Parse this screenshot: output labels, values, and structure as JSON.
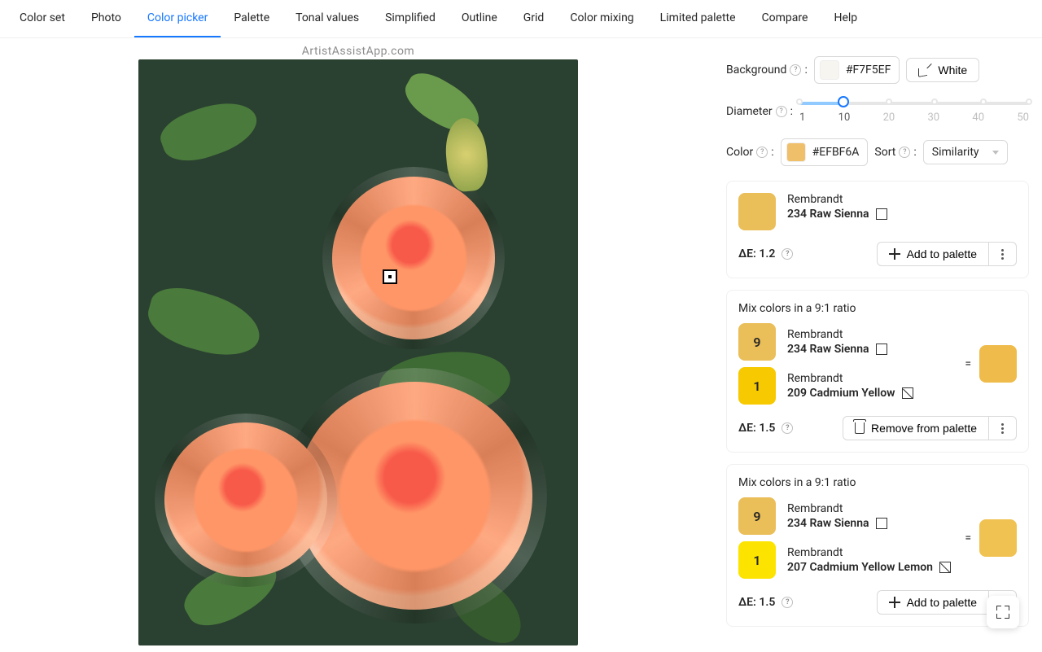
{
  "watermark": "ArtistAssistApp.com",
  "tabs": [
    "Color set",
    "Photo",
    "Color picker",
    "Palette",
    "Tonal values",
    "Simplified",
    "Outline",
    "Grid",
    "Color mixing",
    "Limited palette",
    "Compare",
    "Help"
  ],
  "active_tab_index": 2,
  "background": {
    "label": "Background",
    "value": "#F7F5EF",
    "white_button": "White"
  },
  "diameter": {
    "label": "Diameter",
    "marks": [
      "1",
      "10",
      "20",
      "30",
      "40",
      "50"
    ],
    "value_index": 1
  },
  "color": {
    "label": "Color",
    "value": "#EFBF6A"
  },
  "sort": {
    "label": "Sort",
    "value": "Similarity"
  },
  "delta_prefix": "ΔE: ",
  "add_to_palette": "Add to palette",
  "remove_from_palette": "Remove from palette",
  "cards": [
    {
      "type": "single",
      "swatch": "#EABE59",
      "brand": "Rembrandt",
      "name": "234 Raw Sienna",
      "attr_icon": "square",
      "delta": "1.2",
      "action": "add"
    },
    {
      "type": "mix",
      "mix_label": "Mix colors in a 9:1 ratio",
      "parts": [
        {
          "ratio": "9",
          "swatch": "#EABE59",
          "brand": "Rembrandt",
          "name": "234 Raw Sienna",
          "attr_icon": "square"
        },
        {
          "ratio": "1",
          "swatch": "#F6C900",
          "brand": "Rembrandt",
          "name": "209 Cadmium Yellow",
          "attr_icon": "diag"
        }
      ],
      "result": "#EFBC4B",
      "delta": "1.5",
      "action": "remove"
    },
    {
      "type": "mix",
      "mix_label": "Mix colors in a 9:1 ratio",
      "parts": [
        {
          "ratio": "9",
          "swatch": "#EABE59",
          "brand": "Rembrandt",
          "name": "234 Raw Sienna",
          "attr_icon": "square"
        },
        {
          "ratio": "1",
          "swatch": "#FCE400",
          "brand": "Rembrandt",
          "name": "207 Cadmium Yellow Lemon",
          "attr_icon": "diag"
        }
      ],
      "result": "#F0C251",
      "delta": "1.5",
      "action": "add"
    }
  ]
}
